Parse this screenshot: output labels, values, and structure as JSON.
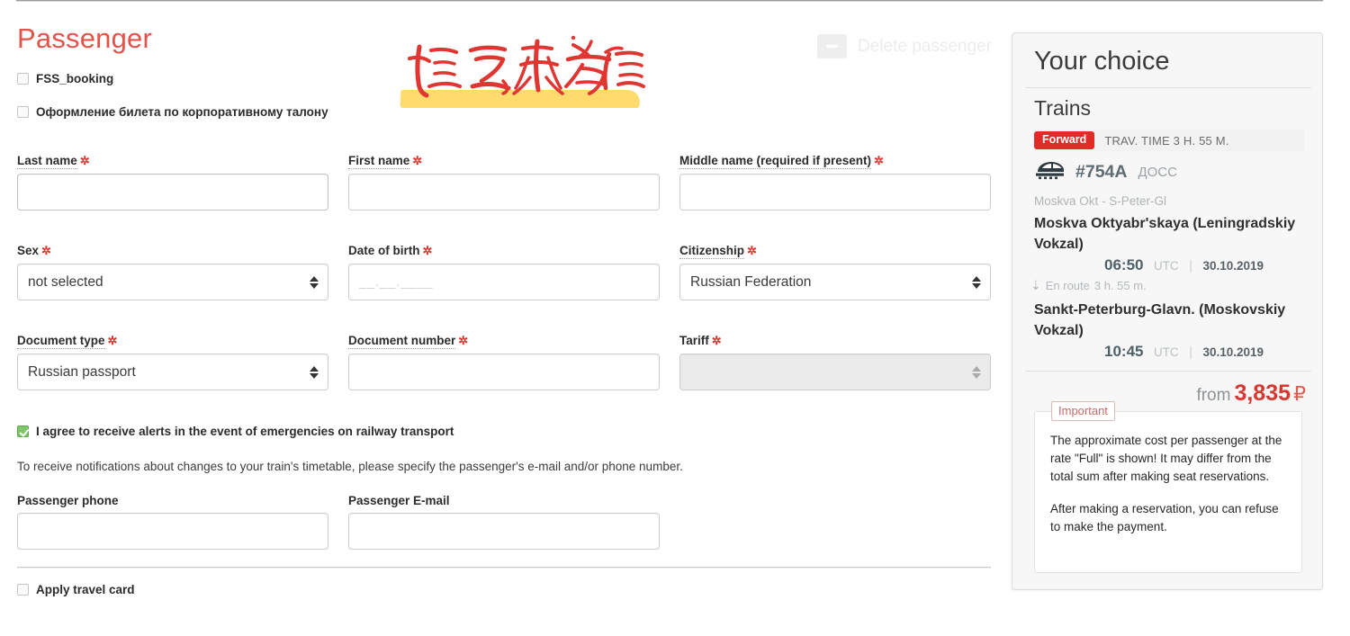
{
  "page": {
    "title": "Passenger",
    "title_color": "#e3534a"
  },
  "toolbar": {
    "delete_passenger_label": "Delete passenger",
    "delete_icon": "minus-icon"
  },
  "annotation": {
    "text": "填写乘客信息",
    "ink_color": "#e03030",
    "highlight_color": "#ffd24d"
  },
  "checkboxes": {
    "fss_booking": {
      "label": "FSS_booking",
      "checked": false
    },
    "corporate_coupon": {
      "label": "Оформление билета по корпоративному талону",
      "checked": false
    },
    "alerts_agree": {
      "label": "I agree to receive alerts in the event of emergencies on railway transport",
      "checked": true
    },
    "travel_card": {
      "label": "Apply travel card",
      "checked": false
    }
  },
  "fields": {
    "last_name": {
      "label": "Last name",
      "required": true,
      "value": "",
      "placeholder": "",
      "focused": true
    },
    "first_name": {
      "label": "First name",
      "required": true,
      "value": "",
      "placeholder": ""
    },
    "middle_name": {
      "label": "Middle name (required if present)",
      "required": true,
      "value": "",
      "placeholder": "",
      "hint": true
    },
    "sex": {
      "label": "Sex",
      "required": true,
      "value": "not selected"
    },
    "date_of_birth": {
      "label": "Date of birth",
      "required": true,
      "value": "",
      "placeholder": "__.__.____"
    },
    "citizenship": {
      "label": "Citizenship",
      "required": true,
      "value": "Russian Federation",
      "hint": true
    },
    "document_type": {
      "label": "Document type",
      "required": true,
      "value": "Russian passport",
      "hint": true
    },
    "document_number": {
      "label": "Document number",
      "required": true,
      "value": "",
      "placeholder": "",
      "hint": true
    },
    "tariff": {
      "label": "Tariff",
      "required": true,
      "value": "",
      "disabled": true
    },
    "passenger_phone": {
      "label": "Passenger phone",
      "required": false,
      "value": "",
      "placeholder": ""
    },
    "passenger_email": {
      "label": "Passenger E-mail",
      "required": false,
      "value": "",
      "placeholder": ""
    }
  },
  "notes": {
    "notification_note": "To receive notifications about changes to your train's timetable, please specify the passenger's e-mail and/or phone number."
  },
  "your_choice": {
    "title": "Your choice",
    "section": "Trains",
    "direction_badge": "Forward",
    "travel_time": "TRAV. TIME 3 H. 55 M.",
    "train_icon": "train-icon",
    "train_number": "#754A",
    "train_category": "ДОСС",
    "route_short": "Moskva Okt - S-Peter-Gl",
    "departure": {
      "station": "Moskva Oktyabr'skaya (Leningradskiy Vokzal)",
      "time": "06:50",
      "tz": "UTC",
      "date": "30.10.2019"
    },
    "en_route_label": "En route",
    "en_route_value": "3 h. 55 m.",
    "arrival": {
      "station": "Sankt-Peterburg-Glavn. (Moskovskiy Vokzal)",
      "time": "10:45",
      "tz": "UTC",
      "date": "30.10.2019"
    },
    "price": {
      "prefix": "from",
      "amount": "3,835",
      "currency": "₽"
    },
    "important": {
      "badge": "Important",
      "paragraph1": "The approximate cost per passenger at the rate \"Full\" is shown! It may differ from the total sum after making seat reservations.",
      "paragraph2": "After making a reservation, you can refuse to make the payment."
    }
  }
}
